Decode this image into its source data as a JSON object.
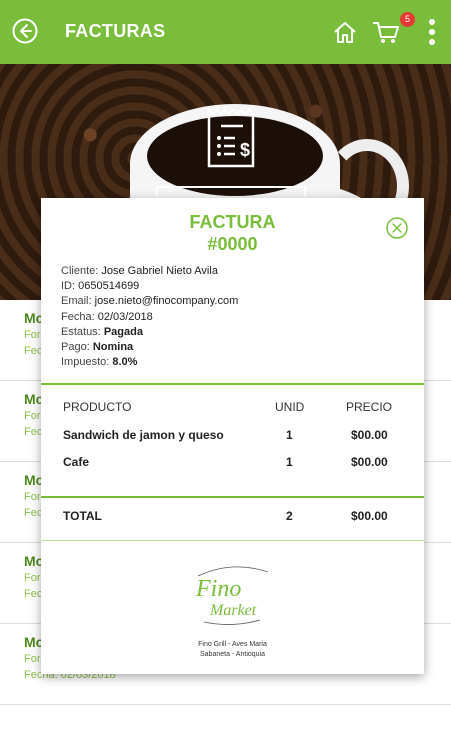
{
  "appbar": {
    "title": "FACTURAS",
    "cart_count": "5"
  },
  "list": [
    {
      "line1": "Mc",
      "line2": "For",
      "line3": "Fec"
    },
    {
      "line1": "Mc",
      "line2": "For",
      "line3": "Fec"
    },
    {
      "line1": "Mc",
      "line2": "For",
      "line3": "Fec"
    },
    {
      "line1": "Mc",
      "line2": "For",
      "line3": "Fec"
    },
    {
      "line1": "Mc",
      "line2": "For",
      "line3": "Fecha: 02/03/2018"
    }
  ],
  "invoice": {
    "title": "FACTURA",
    "number": "#0000",
    "cliente_label": "Cliente:",
    "cliente": "Jose Gabriel Nieto Avila",
    "id_label": "ID:",
    "id": "0650514699",
    "email_label": "Email:",
    "email": "jose.nieto@finocompany.com",
    "fecha_label": "Fecha:",
    "fecha": "02/03/2018",
    "estatus_label": "Estatus:",
    "estatus": "Pagada",
    "pago_label": "Pago:",
    "pago": "Nomina",
    "impuesto_label": "Impuesto:",
    "impuesto": "8.0%",
    "columns": {
      "producto": "PRODUCTO",
      "unid": "UNID",
      "precio": "PRECIO"
    },
    "items": [
      {
        "producto": "Sandwich de jamon y queso",
        "unid": "1",
        "precio": "$00.00"
      },
      {
        "producto": "Cafe",
        "unid": "1",
        "precio": "$00.00"
      }
    ],
    "total": {
      "label": "TOTAL",
      "unid": "2",
      "precio": "$00.00"
    },
    "logo_text": "Fino Market",
    "address1": "Fino Grill - Aves Maria",
    "address2": "Sabaneta - Antioquia"
  },
  "colors": {
    "brand": "#79bd3a",
    "badge": "#e53935"
  }
}
